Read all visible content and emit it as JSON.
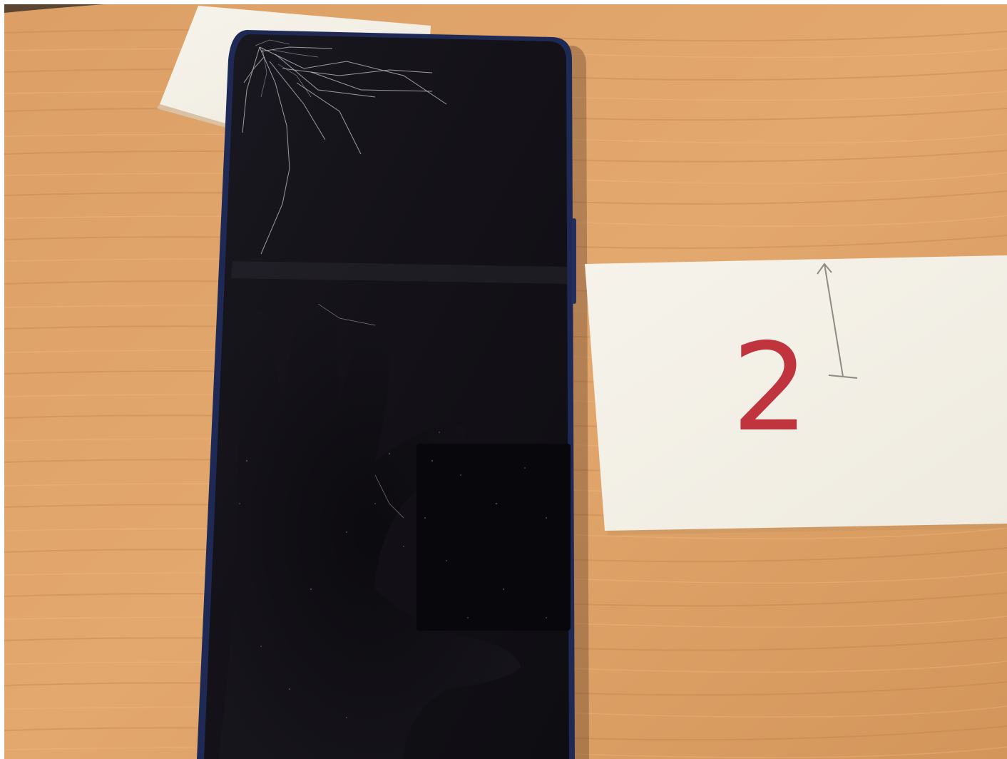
{
  "scene": {
    "description_label": "photo",
    "surface": "wood-desk",
    "colors": {
      "wood_light": "#E2A76D",
      "wood_mid": "#D99A5C",
      "wood_dark": "#C9864A",
      "phone_body": "#15131C",
      "phone_edge": "#1E2A55",
      "paper": "#F4F1E8",
      "paper_shadow": "#E8E3D6",
      "ink_red": "#C0343E",
      "pencil": "#8E8A86"
    }
  },
  "note_card": {
    "handwritten_text": "2"
  }
}
